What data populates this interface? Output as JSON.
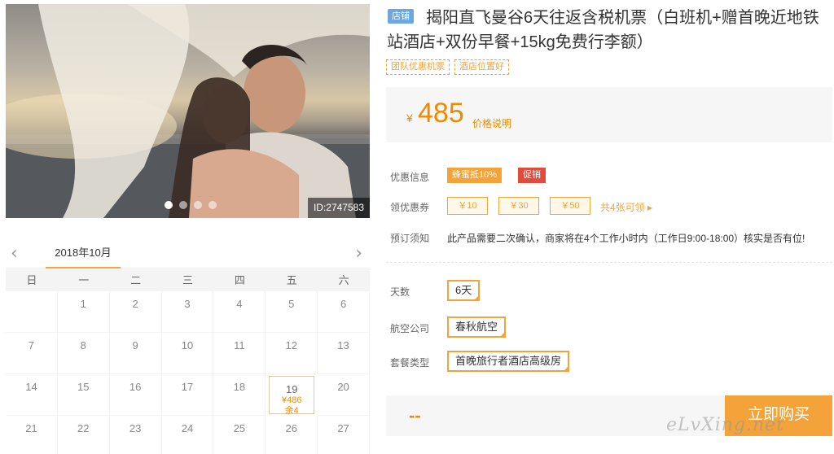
{
  "photo": {
    "id_label": "ID:2747583",
    "dots": 4,
    "active_dot": 0
  },
  "calendar": {
    "month": "2018年10月",
    "prev": "‹",
    "next": "›",
    "weekdays": [
      "日",
      "一",
      "二",
      "三",
      "四",
      "五",
      "六"
    ],
    "weeks": [
      [
        "",
        "1",
        "2",
        "3",
        "4",
        "5",
        "6"
      ],
      [
        "7",
        "8",
        "9",
        "10",
        "11",
        "12",
        "13"
      ],
      [
        "14",
        "15",
        "16",
        "17",
        "18",
        "19",
        "20"
      ],
      [
        "21",
        "22",
        "23",
        "24",
        "25",
        "26",
        "27"
      ]
    ],
    "active_day": {
      "day": "19",
      "price": "¥486",
      "stock": "余4"
    }
  },
  "product": {
    "badge": "店铺",
    "title": "揭阳直飞曼谷6天往返含税机票（白班机+赠首晚近地铁站酒店+双份早餐+15kg免费行李额）",
    "tags": [
      "团队优惠机票",
      "酒店位置好"
    ]
  },
  "price": {
    "currency": "¥",
    "value": "485",
    "note": "价格说明"
  },
  "info": {
    "promo_label": "优惠信息",
    "promo_1": "蜂蜜抵10%",
    "promo_2": "促销",
    "coupon_label": "领优惠券",
    "coupons": [
      "￥10",
      "￥30",
      "￥50"
    ],
    "coupon_total": "共4张可领 ▸",
    "notice_label": "预订须知",
    "notice_text": "此产品需要二次确认，商家将在4个工作小时内（工作日9:00-18:00）核实是否有位!"
  },
  "options": {
    "days_label": "天数",
    "days_value": "6天",
    "airline_label": "航空公司",
    "airline_value": "春秋航空",
    "package_label": "套餐类型",
    "package_value": "首晚旅行者酒店高级房"
  },
  "buy": {
    "total": "--",
    "button": "立即购买"
  },
  "watermark": "eLvXing.net",
  "colors": {
    "accent": "#f3a33a",
    "price": "#f08a00",
    "sale": "#e24a3a",
    "badge": "#6ea7e0"
  }
}
